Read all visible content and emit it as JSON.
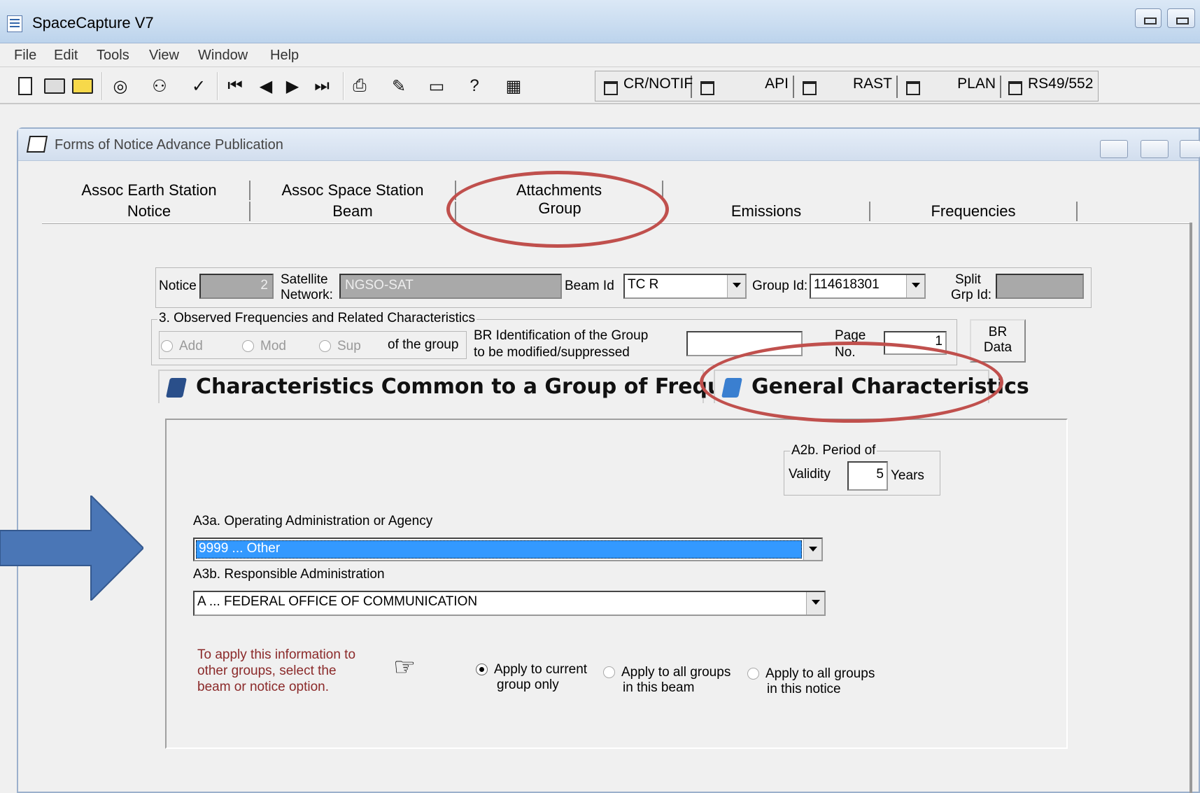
{
  "app": {
    "title": "SpaceCapture V7"
  },
  "menu": [
    "File",
    "Edit",
    "Tools",
    "View",
    "Window",
    "Help"
  ],
  "toolbar": {
    "icons": [
      "new-file-icon",
      "open-icon",
      "folder-icon",
      "glasses-icon",
      "binoculars-icon",
      "check-icon",
      "first-icon",
      "prev-icon",
      "next-icon",
      "last-icon",
      "print-icon",
      "edit-icon",
      "screen-icon",
      "help-icon",
      "calc-icon"
    ],
    "tabs": [
      "CR/NOTIF",
      "API",
      "RAST",
      "PLAN",
      "RS49/552"
    ]
  },
  "child": {
    "title": "Forms of Notice Advance Publication"
  },
  "tabs": {
    "row1": [
      "Assoc Earth Station",
      "Assoc Space Station",
      "Attachments"
    ],
    "row2": [
      "Notice",
      "Beam",
      "Group",
      "Emissions",
      "Frequencies"
    ]
  },
  "notice_panel": {
    "notice_label": "Notice",
    "notice_value": "2",
    "satellite_label_1": "Satellite",
    "satellite_label_2": "Network:",
    "satellite_value": "NGSO-SAT",
    "beam_label": "Beam Id",
    "beam_value": "TC R",
    "group_label": "Group Id:",
    "group_value": "114618301",
    "split_label_1": "Split",
    "split_label_2": "Grp Id:",
    "split_value": ""
  },
  "observed": {
    "legend": "3. Observed Frequencies and Related Characteristics",
    "add": "Add",
    "mod": "Mod",
    "sup": "Sup",
    "of_group": "of the group",
    "br_ident_1": "BR Identification of the Group",
    "br_ident_2": "to be modified/suppressed",
    "br_ident_value": "",
    "page_label_1": "Page",
    "page_label_2": "No.",
    "page_value": "1",
    "br_data_1": "BR",
    "br_data_2": "Data"
  },
  "subtabs": {
    "common": "Characteristics Common to a Group of Frequencies",
    "general": "General Characteristics"
  },
  "period": {
    "legend": "A2b. Period of",
    "validity_label": "Validity",
    "value": "5",
    "unit": "Years"
  },
  "a3a": {
    "label": "A3a.  Operating Administration or Agency",
    "value": "9999  ... Other"
  },
  "a3b": {
    "label": "A3b.  Responsible Administration",
    "value": "A  ... FEDERAL OFFICE OF COMMUNICATION"
  },
  "apply": {
    "hint": "To apply this information to other groups, select the beam or notice option.",
    "current_1": "Apply to current",
    "current_2": "group only",
    "beam_1": "Apply to all groups",
    "beam_2": "in this beam",
    "notice_1": "Apply to all groups",
    "notice_2": "in this notice",
    "selected": "current"
  },
  "colors": {
    "annotation_red": "#c0504d",
    "annotation_blue": "#4a76b6",
    "selection_blue": "#3399ff"
  }
}
